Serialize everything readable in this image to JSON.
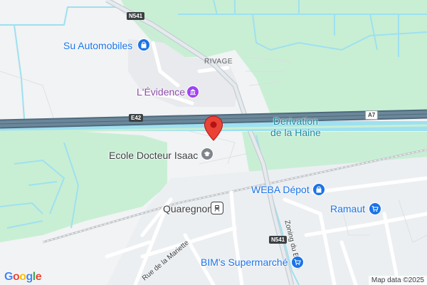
{
  "map": {
    "pois": [
      {
        "name": "Su Automobiles",
        "icon": "shopping-bag-icon"
      },
      {
        "name": "L'Évidence",
        "icon": "museum-icon"
      },
      {
        "name": "Ecole Docteur Isaac",
        "icon": "school-icon"
      },
      {
        "name": "WEBA Dépot",
        "icon": "shopping-bag-icon"
      },
      {
        "name": "Quaregnon",
        "icon": "train-station-icon"
      },
      {
        "name": "Ramaut",
        "icon": "shopping-cart-icon"
      },
      {
        "name": "BIM's Supermarché",
        "icon": "shopping-cart-icon"
      }
    ],
    "places": {
      "rivage": "RIVAGE"
    },
    "water": {
      "line1": "Derivation",
      "line2": "de la Haine"
    },
    "streets": {
      "mariette": "Rue de la Mariette",
      "zoning": "Zoning du Brûle"
    },
    "roads": {
      "n541_top": "N541",
      "n541_bottom": "N541",
      "e42": "E42",
      "a7": "A7"
    },
    "marker": {
      "icon": "location-pin-icon"
    },
    "google": {
      "G": "G",
      "o1": "o",
      "o2": "o",
      "g": "g",
      "l": "l",
      "e": "e"
    },
    "attribution": "Map data ©2025",
    "colors": {
      "green_area": "#c8efd4",
      "water": "#9fe0f0",
      "highway": "#5f7a8c",
      "road": "#ffffff",
      "marker": "#ea4335"
    }
  }
}
